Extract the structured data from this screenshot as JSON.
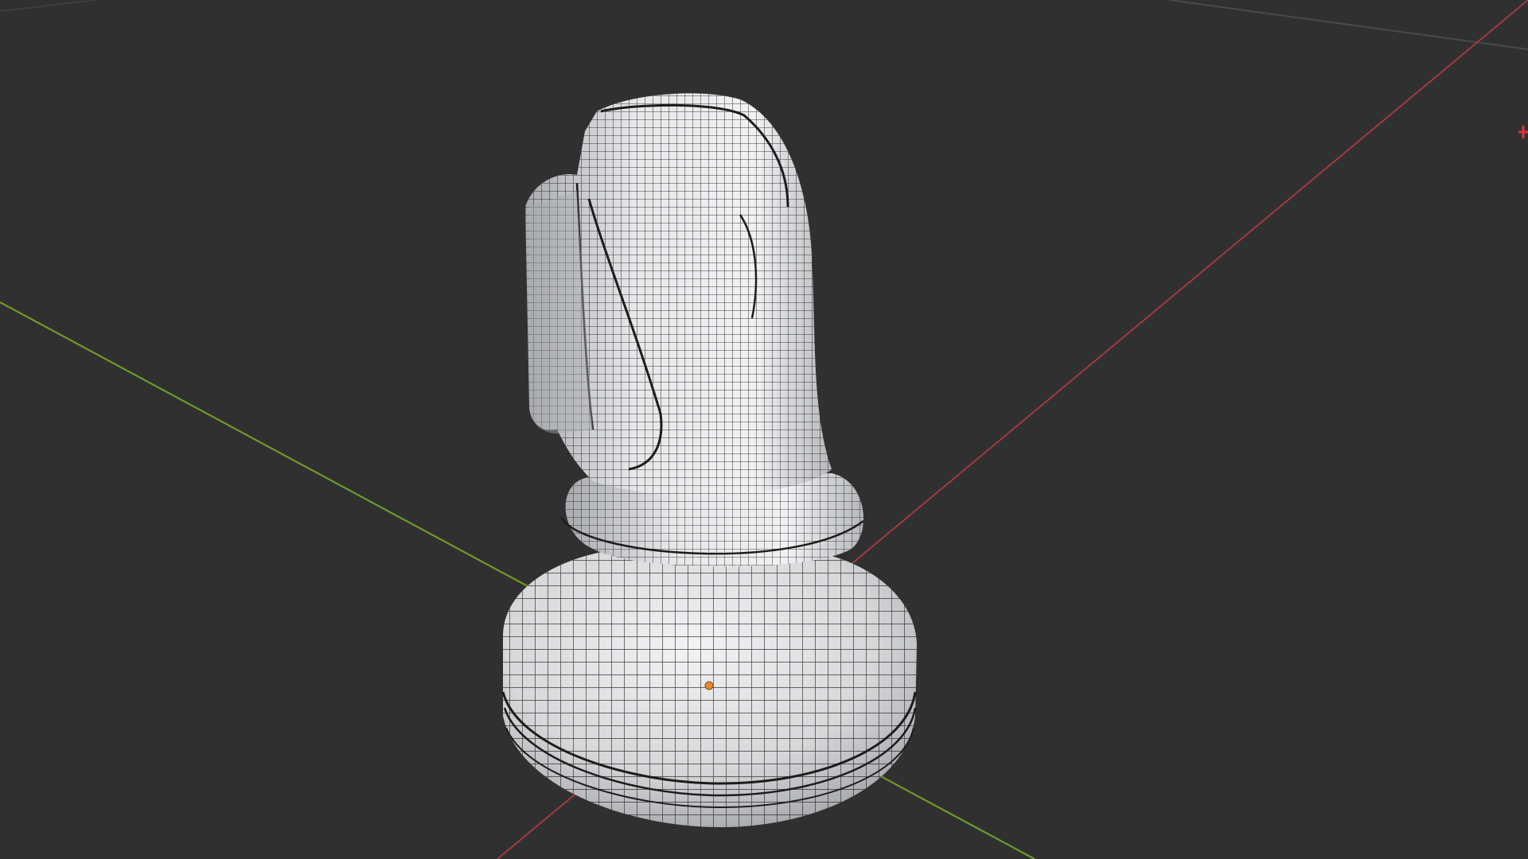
{
  "app": {
    "name": "3D viewport",
    "background_color": "#303030"
  },
  "viewport": {
    "mode": "edit-mode-wireframe-overlay",
    "axes": {
      "x_axis_color": "#9e3b43",
      "y_axis_color": "#6f9a2c"
    },
    "grid_line_color": "#4a4a4a"
  },
  "object": {
    "type": "chess-knight-mesh",
    "surface_color": "#d8d9db",
    "shade_color": "#9ea0a4",
    "wire_color": "#1c1c1c",
    "origin_color": "#e38b2c"
  },
  "gizmo": {
    "marker_color": "#e0343a"
  }
}
